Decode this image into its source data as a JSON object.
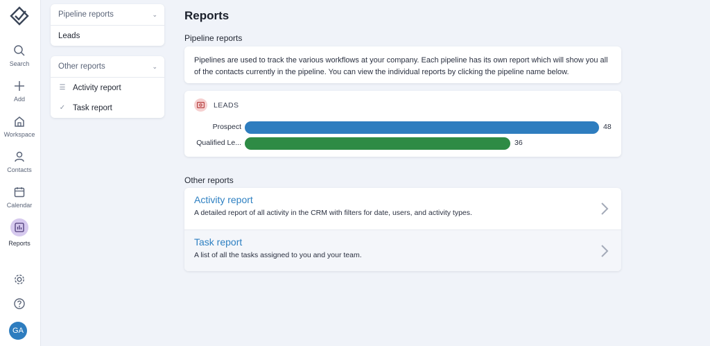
{
  "rail": {
    "items": [
      {
        "label": "Search",
        "icon": "search-icon"
      },
      {
        "label": "Add",
        "icon": "plus-icon"
      },
      {
        "label": "Workspace",
        "icon": "home-icon"
      },
      {
        "label": "Contacts",
        "icon": "person-icon"
      },
      {
        "label": "Calendar",
        "icon": "calendar-icon"
      },
      {
        "label": "Reports",
        "icon": "reports-icon",
        "active": true
      }
    ],
    "avatar_initials": "GA"
  },
  "panel": {
    "pipeline_header": "Pipeline reports",
    "pipeline_items": [
      "Leads"
    ],
    "other_header": "Other reports",
    "other_items": [
      "Activity report",
      "Task report"
    ]
  },
  "main": {
    "title": "Reports",
    "pipeline_section": "Pipeline reports",
    "pipeline_description": "Pipelines are used to track the various workflows at your company. Each pipeline has its own report which will show you all of the contacts currently in the pipeline. You can view the individual reports by clicking the pipeline name below.",
    "leads_title": "LEADS",
    "other_section": "Other reports",
    "reports": [
      {
        "title": "Activity report",
        "description": "A detailed report of all activity in the CRM with filters for date, users, and activity types."
      },
      {
        "title": "Task report",
        "description": "A list of all the tasks assigned to you and your team."
      }
    ]
  },
  "chart_data": {
    "type": "bar",
    "orientation": "horizontal",
    "categories": [
      "Prospect",
      "Qualified Le..."
    ],
    "values": [
      48,
      36
    ],
    "colors": [
      "#2e7dbf",
      "#2e8b45"
    ],
    "title": "LEADS"
  },
  "colors": {
    "accent": "#2e80c2",
    "active_nav": "#d6c9ee",
    "avatar": "#2e7dbf"
  }
}
